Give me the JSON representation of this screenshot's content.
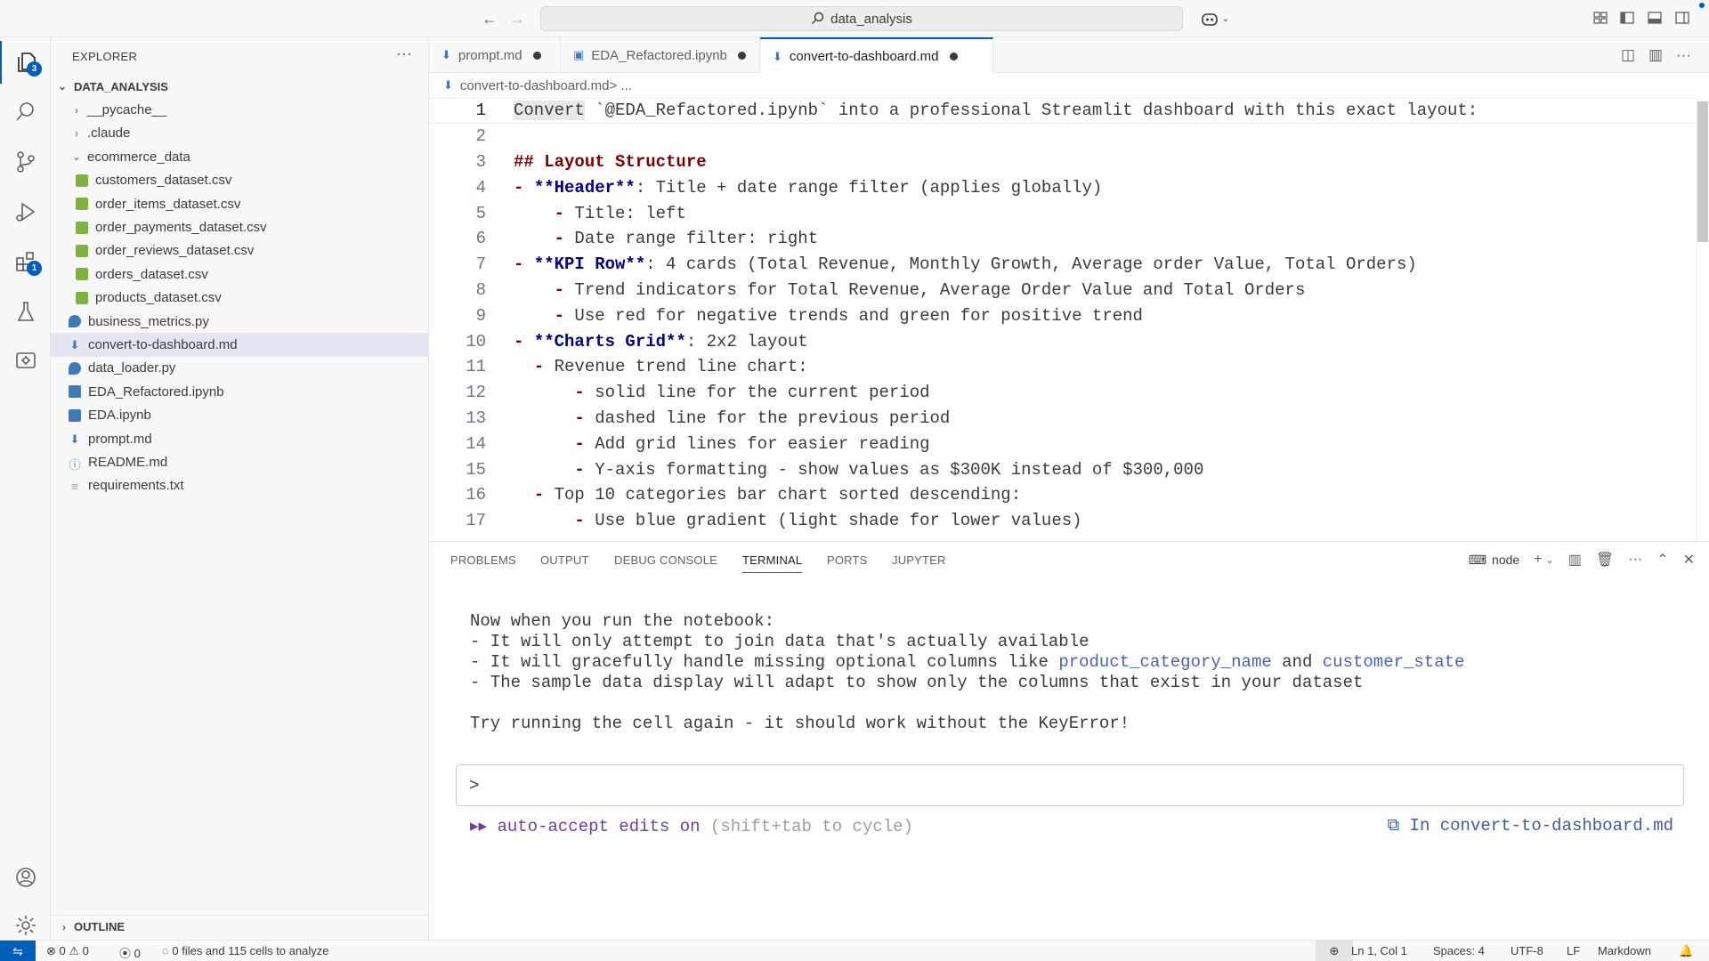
{
  "titlebar": {
    "search_text": "data_analysis"
  },
  "activity": {
    "explorer_badge": "3",
    "extensions_badge": "1"
  },
  "sidebar": {
    "title": "EXPLORER",
    "more": "···",
    "root": "DATA_ANALYSIS",
    "items": [
      {
        "label": "__pycache__",
        "kind": "folder-closed"
      },
      {
        "label": ".claude",
        "kind": "folder-closed"
      },
      {
        "label": "ecommerce_data",
        "kind": "folder-open"
      },
      {
        "label": "customers_dataset.csv",
        "kind": "csv"
      },
      {
        "label": "order_items_dataset.csv",
        "kind": "csv"
      },
      {
        "label": "order_payments_dataset.csv",
        "kind": "csv"
      },
      {
        "label": "order_reviews_dataset.csv",
        "kind": "csv"
      },
      {
        "label": "orders_dataset.csv",
        "kind": "csv"
      },
      {
        "label": "products_dataset.csv",
        "kind": "csv"
      },
      {
        "label": "business_metrics.py",
        "kind": "py"
      },
      {
        "label": "convert-to-dashboard.md",
        "kind": "md"
      },
      {
        "label": "data_loader.py",
        "kind": "py"
      },
      {
        "label": "EDA_Refactored.ipynb",
        "kind": "nb"
      },
      {
        "label": "EDA.ipynb",
        "kind": "nb"
      },
      {
        "label": "prompt.md",
        "kind": "md"
      },
      {
        "label": "README.md",
        "kind": "info"
      },
      {
        "label": "requirements.txt",
        "kind": "txt"
      }
    ],
    "outline": "OUTLINE"
  },
  "tabs": [
    {
      "label": "prompt.md"
    },
    {
      "label": "EDA_Refactored.ipynb"
    },
    {
      "label": "convert-to-dashboard.md"
    }
  ],
  "breadcrumb": {
    "file": "convert-to-dashboard.md",
    "sep": " > ...",
    "icon": "markdown-icon"
  },
  "editor": {
    "lines": [
      {
        "n": "1",
        "parts": [
          {
            "t": "Convert",
            "c": "tok-word"
          },
          {
            "t": " `@EDA_Refactored.ipynb` into a professional Streamlit dashboard with this exact layout:"
          }
        ]
      },
      {
        "n": "2",
        "parts": []
      },
      {
        "n": "3",
        "parts": [
          {
            "t": "## Layout Structure",
            "c": "hl"
          }
        ]
      },
      {
        "n": "4",
        "parts": [
          {
            "t": "- ",
            "c": "hl"
          },
          {
            "t": "**Header**",
            "c": "bold"
          },
          {
            "t": ": Title + date range filter (applies globally)"
          }
        ]
      },
      {
        "n": "5",
        "parts": [
          {
            "t": "    "
          },
          {
            "t": "- ",
            "c": "hl"
          },
          {
            "t": "Title: left"
          }
        ]
      },
      {
        "n": "6",
        "parts": [
          {
            "t": "    "
          },
          {
            "t": "- ",
            "c": "hl"
          },
          {
            "t": "Date range filter: right"
          }
        ]
      },
      {
        "n": "7",
        "parts": [
          {
            "t": "- ",
            "c": "hl"
          },
          {
            "t": "**KPI Row**",
            "c": "bold"
          },
          {
            "t": ": 4 cards (Total Revenue, Monthly Growth, Average order Value, Total Orders)"
          }
        ]
      },
      {
        "n": "8",
        "parts": [
          {
            "t": "    "
          },
          {
            "t": "- ",
            "c": "hl"
          },
          {
            "t": "Trend indicators for Total Revenue, Average Order Value and Total Orders"
          }
        ]
      },
      {
        "n": "9",
        "parts": [
          {
            "t": "    "
          },
          {
            "t": "- ",
            "c": "hl"
          },
          {
            "t": "Use red for negative trends and green for positive trend"
          }
        ]
      },
      {
        "n": "10",
        "parts": [
          {
            "t": "- ",
            "c": "hl"
          },
          {
            "t": "**Charts Grid**",
            "c": "bold"
          },
          {
            "t": ": 2x2 layout"
          }
        ]
      },
      {
        "n": "11",
        "parts": [
          {
            "t": "  "
          },
          {
            "t": "- ",
            "c": "hl"
          },
          {
            "t": "Revenue trend line chart:"
          }
        ]
      },
      {
        "n": "12",
        "parts": [
          {
            "t": "      "
          },
          {
            "t": "- ",
            "c": "hl"
          },
          {
            "t": "solid line for the current period"
          }
        ]
      },
      {
        "n": "13",
        "parts": [
          {
            "t": "      "
          },
          {
            "t": "- ",
            "c": "hl"
          },
          {
            "t": "dashed line for the previous period"
          }
        ]
      },
      {
        "n": "14",
        "parts": [
          {
            "t": "      "
          },
          {
            "t": "- ",
            "c": "hl"
          },
          {
            "t": "Add grid lines for easier reading"
          }
        ]
      },
      {
        "n": "15",
        "parts": [
          {
            "t": "      "
          },
          {
            "t": "- ",
            "c": "hl"
          },
          {
            "t": "Y-axis formatting - show values as $300K instead of $300,000"
          }
        ]
      },
      {
        "n": "16",
        "parts": [
          {
            "t": "  "
          },
          {
            "t": "- ",
            "c": "hl"
          },
          {
            "t": "Top 10 categories bar chart sorted descending:"
          }
        ]
      },
      {
        "n": "17",
        "parts": [
          {
            "t": "      "
          },
          {
            "t": "- ",
            "c": "hl"
          },
          {
            "t": "Use blue gradient (light shade for lower values)"
          }
        ]
      }
    ]
  },
  "panel": {
    "tabs": [
      "PROBLEMS",
      "OUTPUT",
      "DEBUG CONSOLE",
      "TERMINAL",
      "PORTS",
      "JUPYTER"
    ],
    "shell": "node",
    "terminal_lines": [
      [
        {
          "t": "Now when you run the notebook:"
        }
      ],
      [
        {
          "t": "- It will only attempt to join data that's actually available"
        }
      ],
      [
        {
          "t": "- It will gracefully handle missing optional columns like "
        },
        {
          "t": "product_category_name",
          "c": "acc"
        },
        {
          "t": " and "
        },
        {
          "t": "customer_state",
          "c": "acc"
        }
      ],
      [
        {
          "t": "- The sample data display will adapt to show only the columns that exist in your dataset"
        }
      ],
      [
        {
          "t": ""
        }
      ],
      [
        {
          "t": "Try running the cell again - it should work without the KeyError!"
        }
      ]
    ],
    "prompt": ">",
    "auto_accept": "▸▸ auto-accept edits on",
    "auto_accept_hint": "(shift+tab to cycle)",
    "in_file": "⧉ In convert-to-dashboard.md"
  },
  "statusbar": {
    "errors": "0",
    "warnings": "0",
    "ports": "0",
    "analyze": "0 files and 115 cells to analyze",
    "position": "Ln 1, Col 1",
    "spaces": "Spaces: 4",
    "encoding": "UTF-8",
    "eol": "LF",
    "language": "Markdown"
  }
}
